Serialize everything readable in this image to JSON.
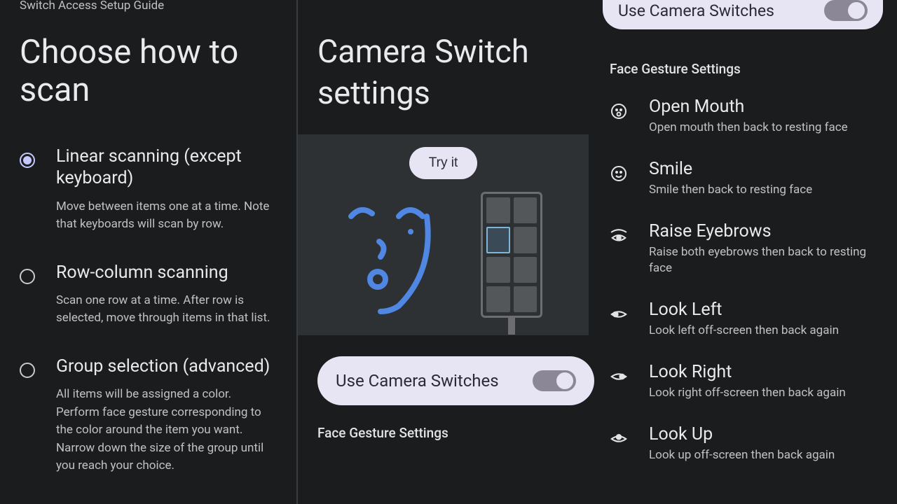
{
  "left": {
    "guide_label": "Switch Access Setup Guide",
    "title": "Choose how to scan",
    "options": [
      {
        "title": "Linear scanning (except keyboard)",
        "desc": "Move between items one at a time. Note that keyboards will scan by row.",
        "selected": true
      },
      {
        "title": "Row-column scanning",
        "desc": "Scan one row at a time. After row is selected, move through items in that list.",
        "selected": false
      },
      {
        "title": "Group selection (advanced)",
        "desc": "All items will be assigned a color. Perform face gesture corresponding to the color around the item you want. Narrow down the size of the group until you reach your choice.",
        "selected": false
      }
    ]
  },
  "middle": {
    "title": "Camera Switch settings",
    "try_it_label": "Try it",
    "toggle_label": "Use Camera Switches",
    "fg_label": "Face Gesture Settings"
  },
  "right": {
    "top_toggle_label": "Use Camera Switches",
    "header": "Face Gesture Settings",
    "gestures": [
      {
        "title": "Open Mouth",
        "desc": "Open mouth then back to resting face",
        "icon": "surprise"
      },
      {
        "title": "Smile",
        "desc": "Smile then back to resting face",
        "icon": "smile"
      },
      {
        "title": "Raise Eyebrows",
        "desc": "Raise both eyebrows then back to resting face",
        "icon": "eyebrow"
      },
      {
        "title": "Look Left",
        "desc": "Look left off-screen then back again",
        "icon": "eye-left"
      },
      {
        "title": "Look Right",
        "desc": "Look right off-screen then back again",
        "icon": "eye-right"
      },
      {
        "title": "Look Up",
        "desc": "Look up off-screen then back again",
        "icon": "eye-up"
      }
    ]
  }
}
